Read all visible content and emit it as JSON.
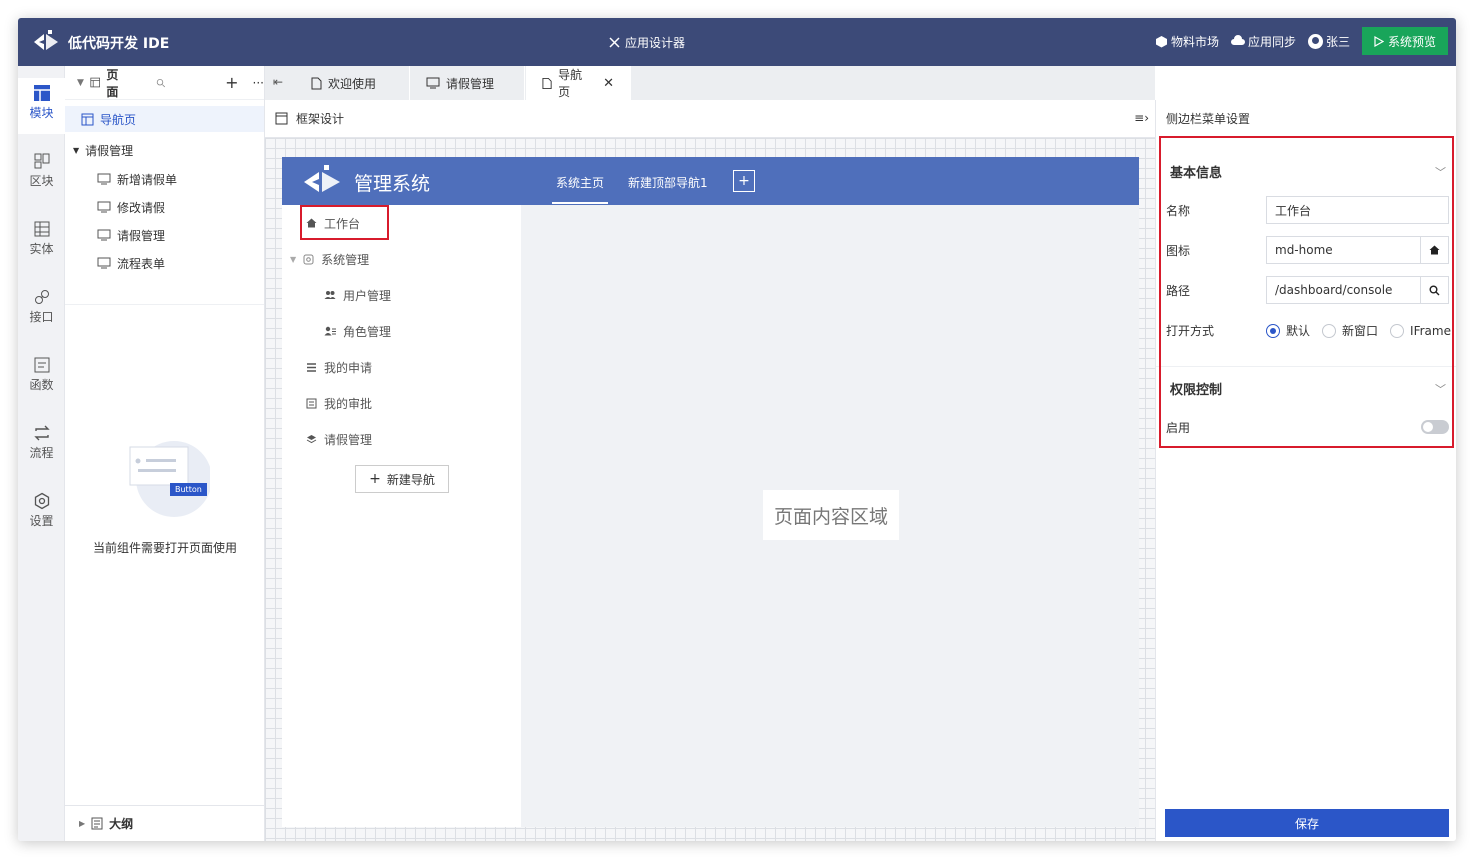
{
  "app": {
    "title": "低代码开发 IDE",
    "center_title": "应用设计器"
  },
  "topbar": {
    "market": "物料市场",
    "sync": "应用同步",
    "user": "张三",
    "preview": "系统预览"
  },
  "iconbar": {
    "items": [
      {
        "label": "模块",
        "icon": "module-icon"
      },
      {
        "label": "区块",
        "icon": "block-icon"
      },
      {
        "label": "实体",
        "icon": "entity-icon"
      },
      {
        "label": "接口",
        "icon": "api-icon"
      },
      {
        "label": "函数",
        "icon": "function-icon"
      },
      {
        "label": "流程",
        "icon": "flow-icon"
      },
      {
        "label": "设置",
        "icon": "settings-icon"
      }
    ]
  },
  "panel": {
    "head": "页面",
    "tree": {
      "nav_page": "导航页",
      "group": "请假管理",
      "children": [
        "新增请假单",
        "修改请假",
        "请假管理",
        "流程表单"
      ]
    },
    "empty_badge": "Button",
    "empty_text": "当前组件需要打开页面使用",
    "outline": "大纲"
  },
  "tabs": [
    {
      "label": "欢迎使用"
    },
    {
      "label": "请假管理"
    },
    {
      "label": "导航页"
    }
  ],
  "subhead": {
    "label": "框架设计"
  },
  "frame": {
    "title": "管理系统",
    "top_tabs": [
      "系统主页",
      "新建顶部导航1"
    ],
    "plus": "+",
    "side": {
      "workbench": "工作台",
      "sys": "系统管理",
      "user_mgmt": "用户管理",
      "role_mgmt": "角色管理",
      "my_apply": "我的申请",
      "my_approve": "我的审批",
      "leave": "请假管理",
      "new_nav": "新建导航"
    },
    "content": "页面内容区域"
  },
  "right": {
    "title": "侧边栏菜单设置",
    "basic": "基本信息",
    "name_label": "名称",
    "name_value": "工作台",
    "icon_label": "图标",
    "icon_value": "md-home",
    "path_label": "路径",
    "path_value": "/dashboard/console",
    "open_label": "打开方式",
    "open_options": [
      "默认",
      "新窗口",
      "IFrame"
    ],
    "open_selected": "默认",
    "perm": "权限控制",
    "enable_label": "启用",
    "enable_value": false,
    "save": "保存"
  },
  "colors": {
    "topbar": "#3c4a78",
    "accent": "#2b56c8",
    "preview": "#19a55a",
    "frame_header": "#4f6fbb",
    "highlight": "#d81b2c"
  }
}
